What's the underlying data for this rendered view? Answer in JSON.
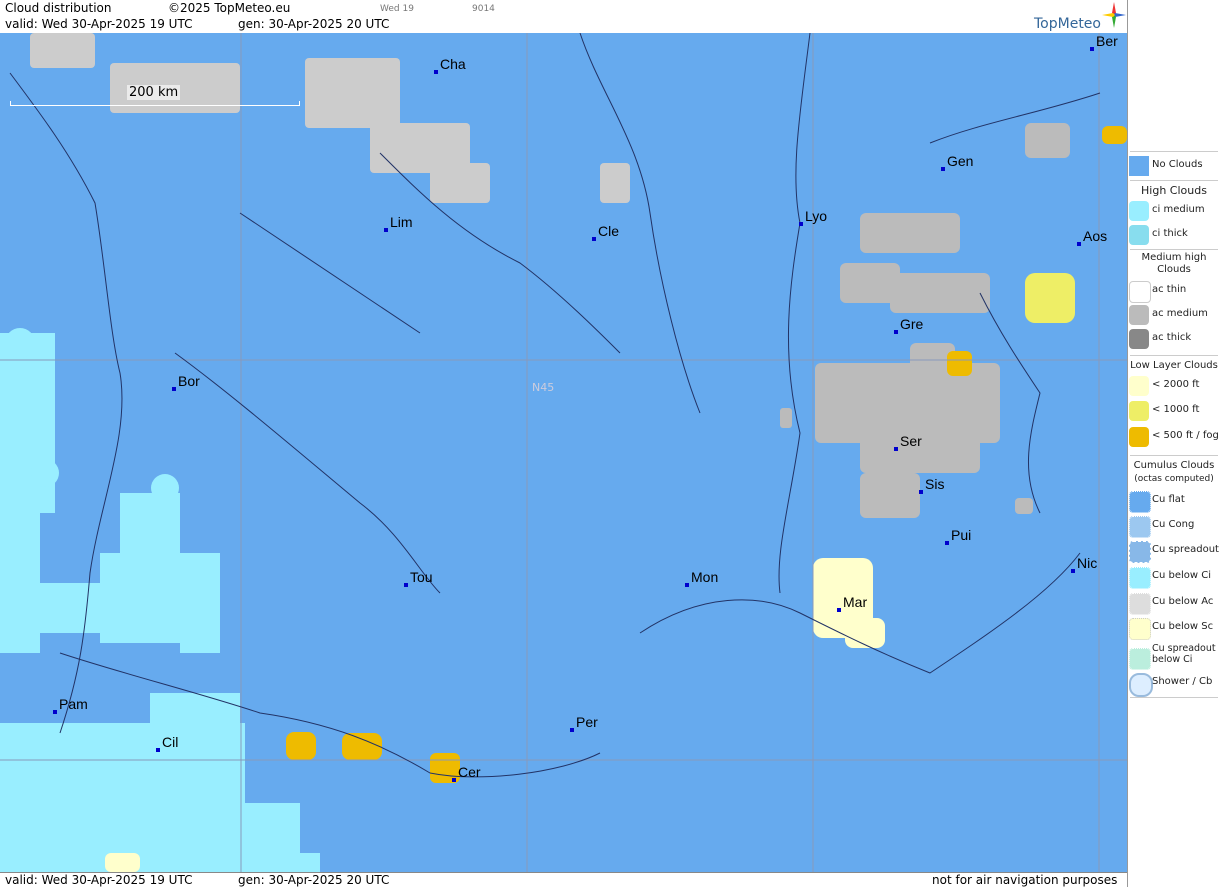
{
  "header": {
    "title": "Cloud distribution",
    "copyright": "©2025 TopMeteo.eu",
    "run_code": "Wed 19",
    "run_id": "9014",
    "valid": "valid:  Wed  30-Apr-2025  19 UTC",
    "generated": "gen: 30-Apr-2025 20 UTC",
    "brand": "TopMeteo"
  },
  "map": {
    "scale_label": "200 km",
    "latitude_label": "N45",
    "cities": [
      {
        "name": "Cha"
      },
      {
        "name": "Ber"
      },
      {
        "name": "Gen"
      },
      {
        "name": "Lim"
      },
      {
        "name": "Cle"
      },
      {
        "name": "Lyo"
      },
      {
        "name": "Aos"
      },
      {
        "name": "Gre"
      },
      {
        "name": "Bor"
      },
      {
        "name": "Ser"
      },
      {
        "name": "Sis"
      },
      {
        "name": "Pui"
      },
      {
        "name": "Tou"
      },
      {
        "name": "Mon"
      },
      {
        "name": "Nic"
      },
      {
        "name": "Mar"
      },
      {
        "name": "Pam"
      },
      {
        "name": "Cil"
      },
      {
        "name": "Per"
      },
      {
        "name": "Cer"
      }
    ]
  },
  "legend": {
    "no_clouds": "No Clouds",
    "high_clouds": "High Clouds",
    "ci_medium": "ci medium",
    "ci_thick": "ci thick",
    "medium_high": "Medium high Clouds",
    "ac_thin": "ac thin",
    "ac_medium": "ac medium",
    "ac_thick": "ac thick",
    "low_layer": "Low Layer Clouds",
    "low_2000": "< 2000 ft",
    "low_1000": "< 1000 ft",
    "low_500": "< 500 ft / fog",
    "cumulus": "Cumulus Clouds",
    "cumulus_sub": "(octas computed)",
    "cu_flat": "Cu flat",
    "cu_cong": "Cu Cong",
    "cu_spreadout": "Cu spreadout",
    "cu_below_ci": "Cu below Ci",
    "cu_below_ac": "Cu below Ac",
    "cu_below_sc": "Cu below Sc",
    "cu_spread_below_ci": "Cu spreadout below Ci",
    "shower_cb": "Shower / Cb"
  },
  "footer": {
    "valid": "valid:  Wed  30-Apr-2025  19 UTC",
    "generated": "gen: 30-Apr-2025 20 UTC",
    "disclaimer": "not for air navigation purposes"
  },
  "colors": {
    "no_clouds": "#66aaee",
    "ci_medium": "#99eeff",
    "ci_thick": "#88ddee",
    "ac_thin": "#ffffff",
    "ac_medium": "#bbbbbb",
    "ac_thick": "#888888",
    "low_2000": "#ffffcc",
    "low_1000": "#eeee66",
    "low_500": "#eebb00"
  }
}
